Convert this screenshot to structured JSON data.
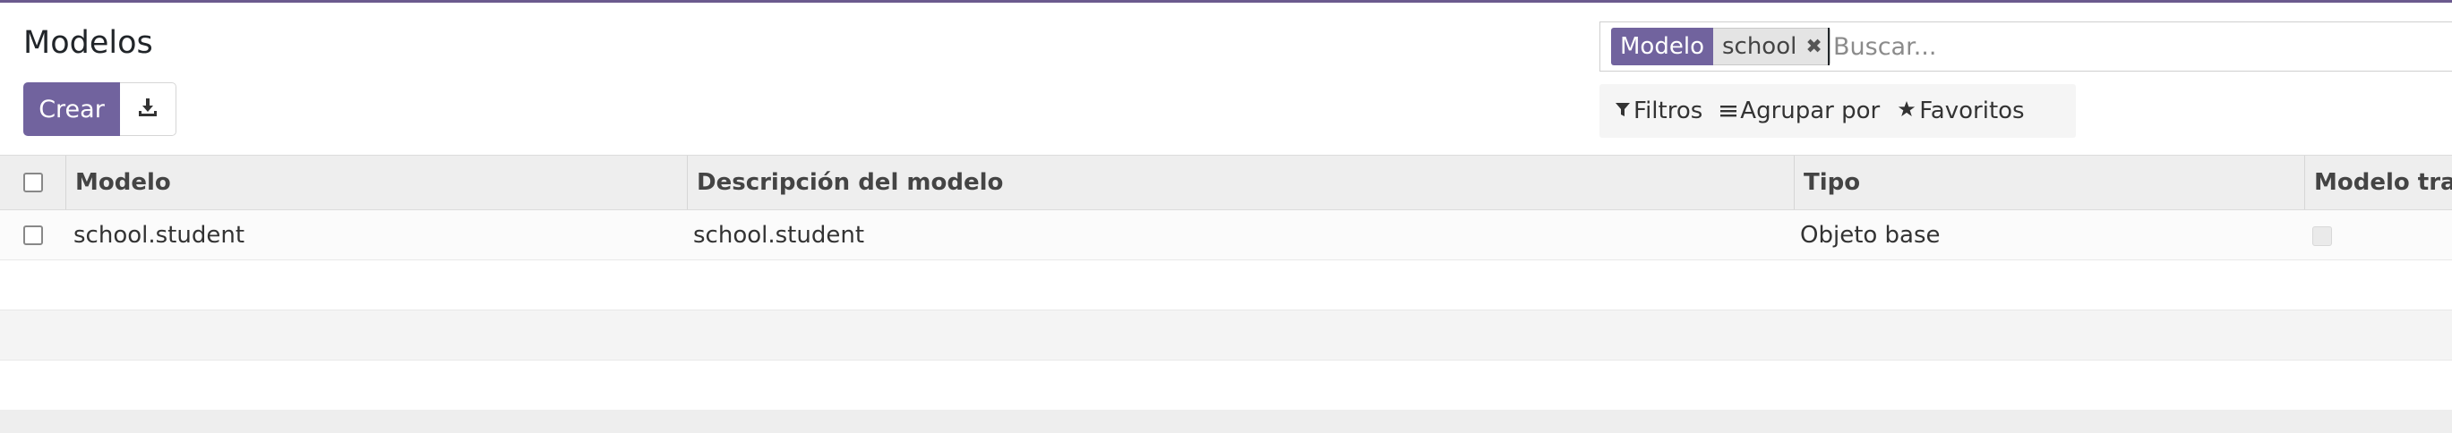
{
  "page": {
    "title": "Modelos"
  },
  "toolbar": {
    "create_label": "Crear",
    "download_icon": "download-icon"
  },
  "search": {
    "facet_label": "Modelo",
    "facet_value": "school",
    "placeholder": "Buscar..."
  },
  "filters": {
    "filters_label": "Filtros",
    "group_by_label": "Agrupar por",
    "favorites_label": "Favoritos"
  },
  "table": {
    "columns": [
      "Modelo",
      "Descripción del modelo",
      "Tipo",
      "Modelo tran"
    ],
    "rows": [
      {
        "model": "school.student",
        "description": "school.student",
        "type": "Objeto base",
        "transient": false
      }
    ]
  },
  "colors": {
    "accent": "#71639e",
    "topbar": "#6b5a8e"
  }
}
